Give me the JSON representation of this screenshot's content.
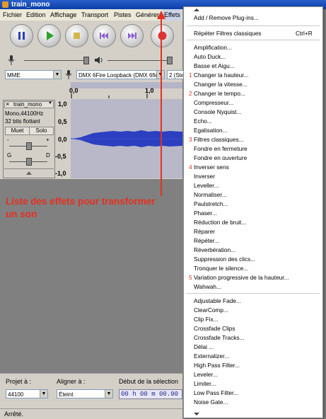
{
  "window": {
    "title": "train_mono"
  },
  "menubar": [
    "Fichier",
    "Edition",
    "Affichage",
    "Transport",
    "Pistes",
    "Générer",
    "Effets"
  ],
  "devices": {
    "host": "MME",
    "output": "DMX 6Fire Loopback (DMX 6fir",
    "channels": "2 (Ste"
  },
  "ruler": {
    "marks": [
      "0,0",
      "1,0"
    ]
  },
  "track": {
    "name": "train_mono",
    "info1": "Mono,44100Hz",
    "info2": "32 bits flottant",
    "mute": "Muet",
    "solo": "Solo",
    "minus": "-",
    "plus": "+",
    "left": "G",
    "right": "D",
    "scale": [
      "1,0",
      "0,5",
      "0,0",
      "-0,5",
      "-1,0"
    ]
  },
  "annotation": {
    "line1": "Liste des effets pour transformer",
    "line2": "un son"
  },
  "bottom": {
    "project_label": "Projet à :",
    "project_rate": "44100",
    "snap_label": "Aligner à :",
    "snap_value": "Éteint",
    "selection_label": "Début de la sélection",
    "time": "00 h 00 m 00.00"
  },
  "status": "Arrêté.",
  "effects_menu": {
    "header": [
      "Add / Remove Plug-ins..."
    ],
    "repeat": {
      "label": "Répéter Filtres classiques",
      "shortcut": "Ctrl+R"
    },
    "builtin": [
      {
        "label": "Amplification..."
      },
      {
        "label": "Auto Duck..."
      },
      {
        "label": "Basse et Aigu..."
      },
      {
        "label": "Changer la hauteur...",
        "num": "1"
      },
      {
        "label": "Changer la vitesse..."
      },
      {
        "label": "Changer le tempo...",
        "num": "2"
      },
      {
        "label": "Compresseur..."
      },
      {
        "label": "Console Nyquist..."
      },
      {
        "label": "Echo..."
      },
      {
        "label": "Egalisation..."
      },
      {
        "label": "Filtres classiques...",
        "num": "3"
      },
      {
        "label": "Fondre en fermeture"
      },
      {
        "label": "Fondre en ouverture"
      },
      {
        "label": "Inverser sens",
        "num": "4"
      },
      {
        "label": "Inverser"
      },
      {
        "label": "Leveller..."
      },
      {
        "label": "Normaliser..."
      },
      {
        "label": "Paulstretch..."
      },
      {
        "label": "Phaser..."
      },
      {
        "label": "Réduction de bruit..."
      },
      {
        "label": "Réparer"
      },
      {
        "label": "Répéter..."
      },
      {
        "label": "Réverbération..."
      },
      {
        "label": "Suppression des clics..."
      },
      {
        "label": "Tronquer le silence..."
      },
      {
        "label": "Variation progressive de la hauteur...",
        "num": "5"
      },
      {
        "label": "Wahwah..."
      }
    ],
    "plugins": [
      "Adjustable Fade...",
      "ClearComp...",
      "Clip Fix...",
      "Crossfade Clips",
      "Crossfade Tracks...",
      "Délai ...",
      "Externalizer...",
      "High Pass Filter...",
      "Leveler...",
      "Limiter...",
      "Low Pass Filter...",
      "Noise Gate..."
    ]
  },
  "colors": {
    "annotation": "#e53020",
    "titlebar": "#0a3fa8",
    "waveform": "#2b3fc0"
  }
}
